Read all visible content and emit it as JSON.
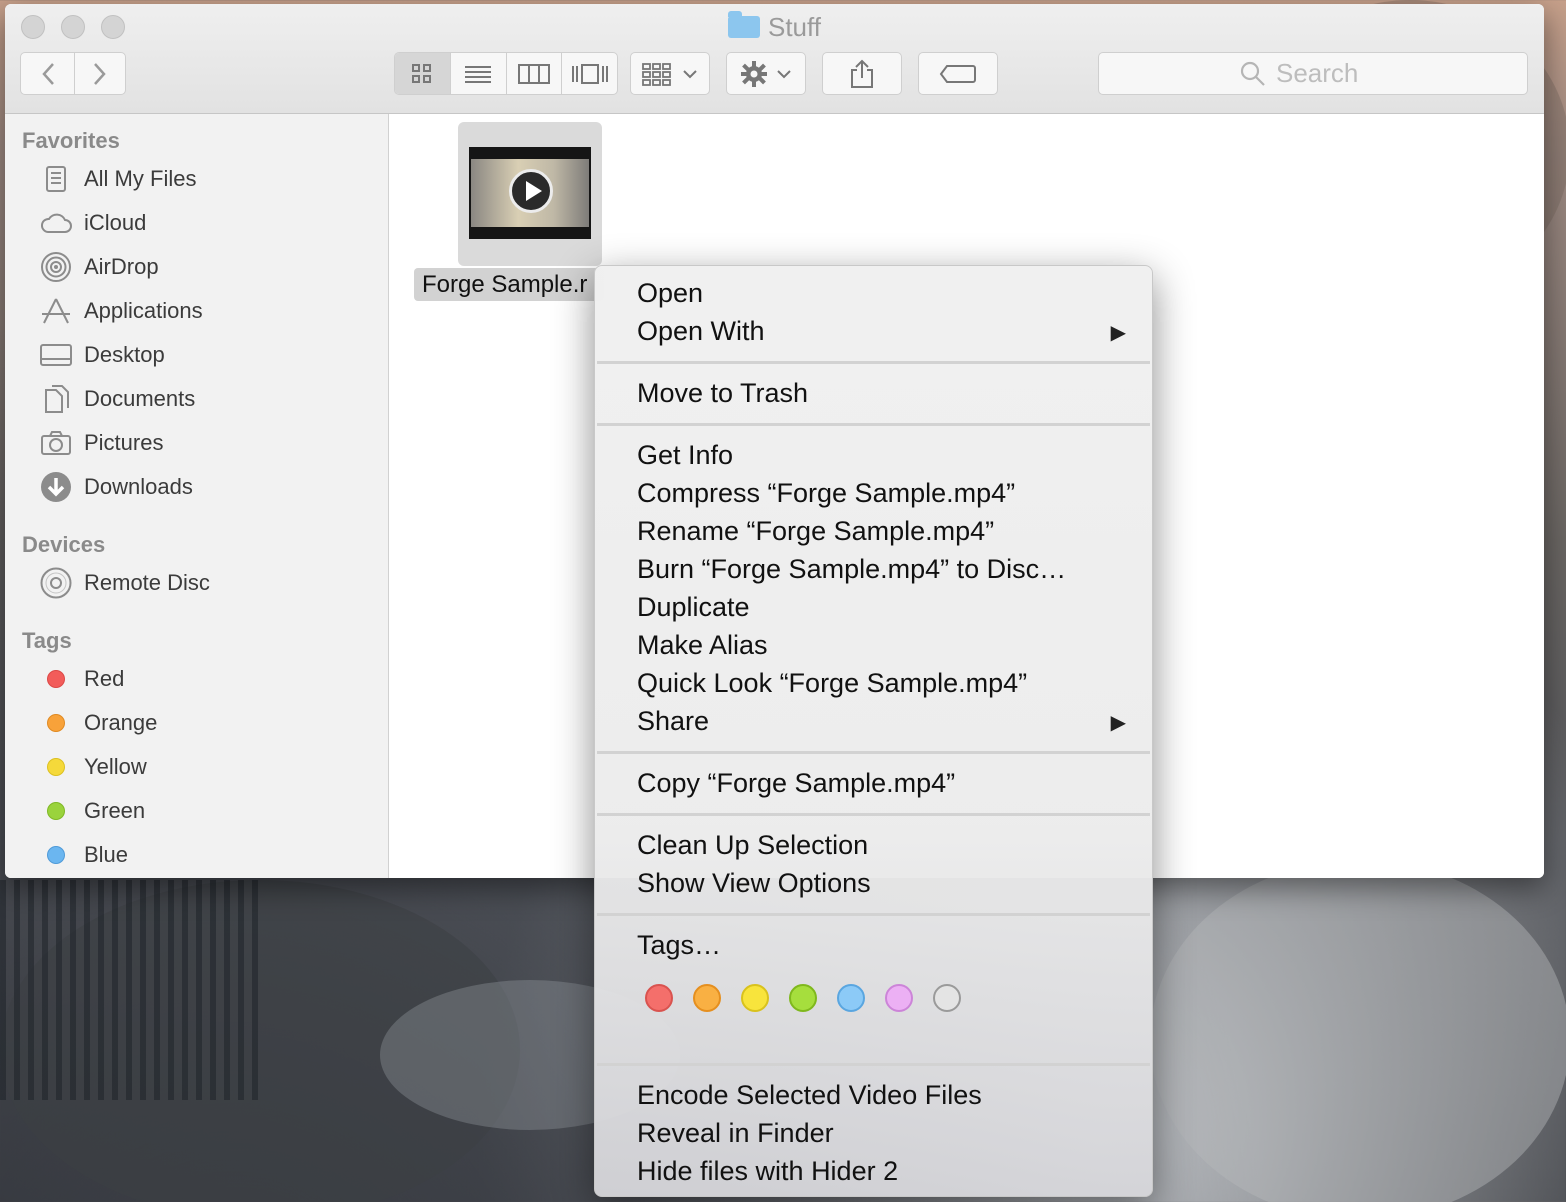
{
  "window": {
    "title": "Stuff"
  },
  "toolbar": {
    "search_placeholder": "Search"
  },
  "sidebar": {
    "sections": {
      "favorites": "Favorites",
      "devices": "Devices",
      "tags": "Tags"
    },
    "favorites": [
      {
        "label": "All My Files",
        "icon": "all-files-icon"
      },
      {
        "label": "iCloud",
        "icon": "cloud-icon"
      },
      {
        "label": "AirDrop",
        "icon": "airdrop-icon"
      },
      {
        "label": "Applications",
        "icon": "applications-icon"
      },
      {
        "label": "Desktop",
        "icon": "desktop-icon"
      },
      {
        "label": "Documents",
        "icon": "documents-icon"
      },
      {
        "label": "Pictures",
        "icon": "camera-icon"
      },
      {
        "label": "Downloads",
        "icon": "download-icon"
      }
    ],
    "devices": [
      {
        "label": "Remote Disc",
        "icon": "disc-icon"
      }
    ],
    "tags": [
      {
        "label": "Red",
        "color": "#f25c5a"
      },
      {
        "label": "Orange",
        "color": "#f8a23a"
      },
      {
        "label": "Yellow",
        "color": "#f5d93a"
      },
      {
        "label": "Green",
        "color": "#9ad33c"
      },
      {
        "label": "Blue",
        "color": "#6bb6f0"
      }
    ]
  },
  "content": {
    "file_label": "Forge Sample.r"
  },
  "context_menu": {
    "items": [
      "Open",
      "Open With",
      "Move to Trash",
      "Get Info",
      "Compress “Forge Sample.mp4”",
      "Rename “Forge Sample.mp4”",
      "Burn “Forge Sample.mp4” to Disc…",
      "Duplicate",
      "Make Alias",
      "Quick Look “Forge Sample.mp4”",
      "Share",
      "Copy “Forge Sample.mp4”",
      "Clean Up Selection",
      "Show View Options",
      "Tags…",
      "Encode Selected Video Files",
      "Reveal in Finder",
      "Hide files with Hider 2"
    ],
    "submenu_arrow": "▶",
    "tag_colors": [
      {
        "name": "red",
        "fill": "#f46f6b",
        "stroke": "#d9534f"
      },
      {
        "name": "orange",
        "fill": "#f9b043",
        "stroke": "#e58f1f"
      },
      {
        "name": "yellow",
        "fill": "#f8e43c",
        "stroke": "#d9c21d"
      },
      {
        "name": "green",
        "fill": "#a6de3d",
        "stroke": "#7fb81d"
      },
      {
        "name": "blue",
        "fill": "#8ccaf7",
        "stroke": "#5aa6e0"
      },
      {
        "name": "purple",
        "fill": "#ecb0f4",
        "stroke": "#cc84d8"
      },
      {
        "name": "gray",
        "fill": "#e4e4e4",
        "stroke": "#9a9a9a"
      }
    ]
  }
}
